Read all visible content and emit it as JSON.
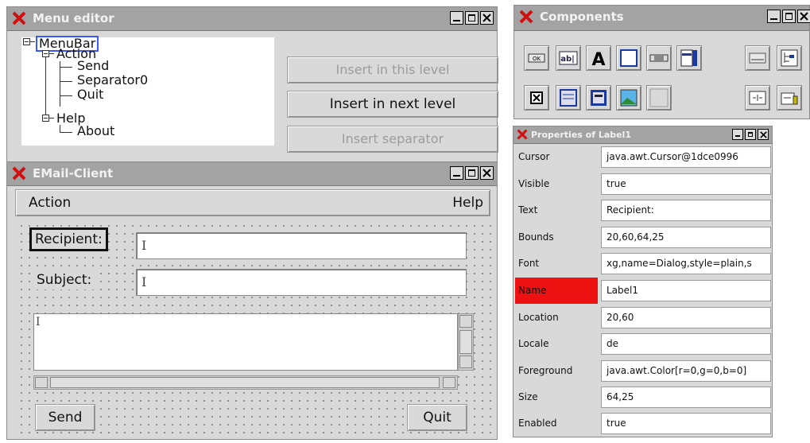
{
  "menu_editor": {
    "title": "Menu editor",
    "tree": {
      "root": "MenuBar",
      "action": "Action",
      "send": "Send",
      "separator": "Separator0",
      "quit": "Quit",
      "help": "Help",
      "about": "About"
    },
    "buttons": {
      "insert_this_level": "Insert in this level",
      "insert_next_level": "Insert in next level",
      "insert_separator": "Insert separator"
    }
  },
  "email_client": {
    "title": "EMail-Client",
    "menu": {
      "action": "Action",
      "help": "Help"
    },
    "labels": {
      "recipient": "Recipient:",
      "subject": "Subject:"
    },
    "buttons": {
      "send": "Send",
      "quit": "Quit"
    }
  },
  "components": {
    "title": "Components",
    "items": [
      "ok-button-icon",
      "textfield-icon",
      "label-icon",
      "panel-icon",
      "scrollbar-icon",
      "list-icon",
      "separator-icon",
      "tree-icon",
      "checkbox-icon",
      "textarea-icon",
      "table-icon",
      "image-icon",
      "empty-panel-icon",
      "splitpane-icon",
      "textblock-icon"
    ],
    "ok_glyph": "OK",
    "textfield_glyph": "ab|",
    "label_glyph": "A"
  },
  "properties": {
    "title": "Properties of Label1",
    "rows": [
      {
        "key": "Cursor",
        "value": "java.awt.Cursor@1dce0996"
      },
      {
        "key": "Visible",
        "value": "true"
      },
      {
        "key": "Text",
        "value": "Recipient:"
      },
      {
        "key": "Bounds",
        "value": "20,60,64,25"
      },
      {
        "key": "Font",
        "value": "xg,name=Dialog,style=plain,s"
      },
      {
        "key": "Name",
        "value": "Label1"
      },
      {
        "key": "Location",
        "value": "20,60"
      },
      {
        "key": "Locale",
        "value": "de"
      },
      {
        "key": "Foreground",
        "value": "java.awt.Color[r=0,g=0,b=0]"
      },
      {
        "key": "Size",
        "value": "64,25"
      },
      {
        "key": "Enabled",
        "value": "true"
      }
    ]
  },
  "colors": {
    "titlebar": "#a3a3a3",
    "window": "#d9d9d9",
    "selection": "#3b57ff",
    "name_highlight": "#ee1111",
    "close_x": "#d01010"
  }
}
